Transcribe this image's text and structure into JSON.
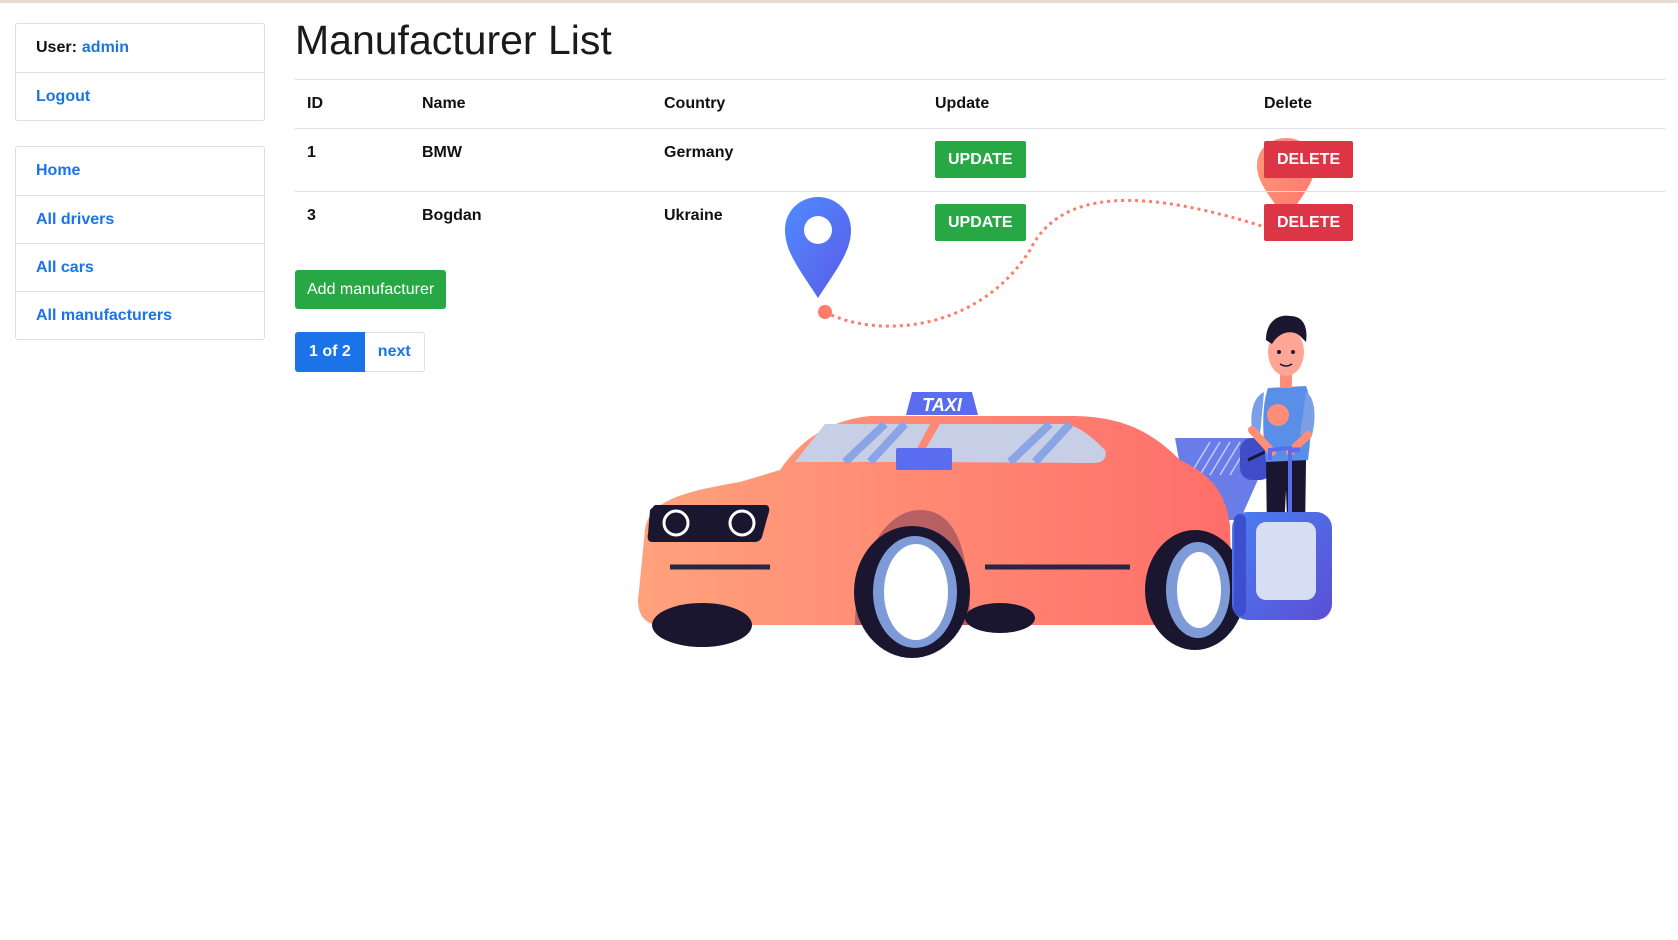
{
  "user": {
    "label": "User:",
    "name": "admin"
  },
  "logout_label": "Logout",
  "nav": [
    {
      "label": "Home"
    },
    {
      "label": "All drivers"
    },
    {
      "label": "All cars"
    },
    {
      "label": "All manufacturers"
    }
  ],
  "page_title": "Manufacturer List",
  "table": {
    "headers": [
      "ID",
      "Name",
      "Country",
      "Update",
      "Delete"
    ],
    "rows": [
      {
        "id": "1",
        "name": "BMW",
        "country": "Germany",
        "update": "UPDATE",
        "delete": "DELETE"
      },
      {
        "id": "3",
        "name": "Bogdan",
        "country": "Ukraine",
        "update": "UPDATE",
        "delete": "DELETE"
      }
    ]
  },
  "add_button": "Add manufacturer",
  "pagination": {
    "current": "1 of 2",
    "next": "next"
  },
  "illustration": {
    "sign_text": "TAXI"
  },
  "colors": {
    "link": "#1a74e8",
    "success": "#28a745",
    "danger": "#dc3545",
    "car_body": "#ff8d78",
    "pin_blue": "#4d6bf0",
    "pin_coral": "#ff8d78"
  }
}
